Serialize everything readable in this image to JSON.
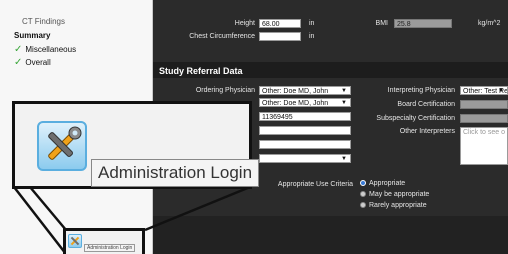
{
  "sidebar": {
    "items": [
      {
        "label": "CT Findings",
        "checked": false
      },
      {
        "label": "Summary",
        "heading": true
      },
      {
        "label": "Miscellaneous",
        "checked": true
      },
      {
        "label": "Overall",
        "checked": true
      }
    ]
  },
  "vitals": {
    "height_label": "Height",
    "height_value": "68.00",
    "height_unit": "in",
    "chest_label": "Chest Circumference",
    "chest_value": "",
    "chest_unit": "in",
    "bmi_label": "BMI",
    "bmi_value": "25.8",
    "bmi_unit": "kg/m^2"
  },
  "referral": {
    "title": "Study Referral Data",
    "ordering_label": "Ordering Physician",
    "ordering_value": "Other: Doe MD, John",
    "referring_value": "Other: Doe MD, John",
    "id_value": "11369495",
    "interpreting_label": "Interpreting Physician",
    "interpreting_value": "Other: Test Re",
    "board_label": "Board Certification",
    "subspecialty_label": "Subspecialty Certification",
    "other_label": "Other Interpreters",
    "other_placeholder": "Click to see o",
    "auc_label": "Appropriate Use Criteria",
    "auc_options": [
      "Appropriate",
      "May be appropriate",
      "Rarely appropriate"
    ]
  },
  "zoom": {
    "tooltip": "Administration Login",
    "small_tooltip": "Administration Login"
  }
}
